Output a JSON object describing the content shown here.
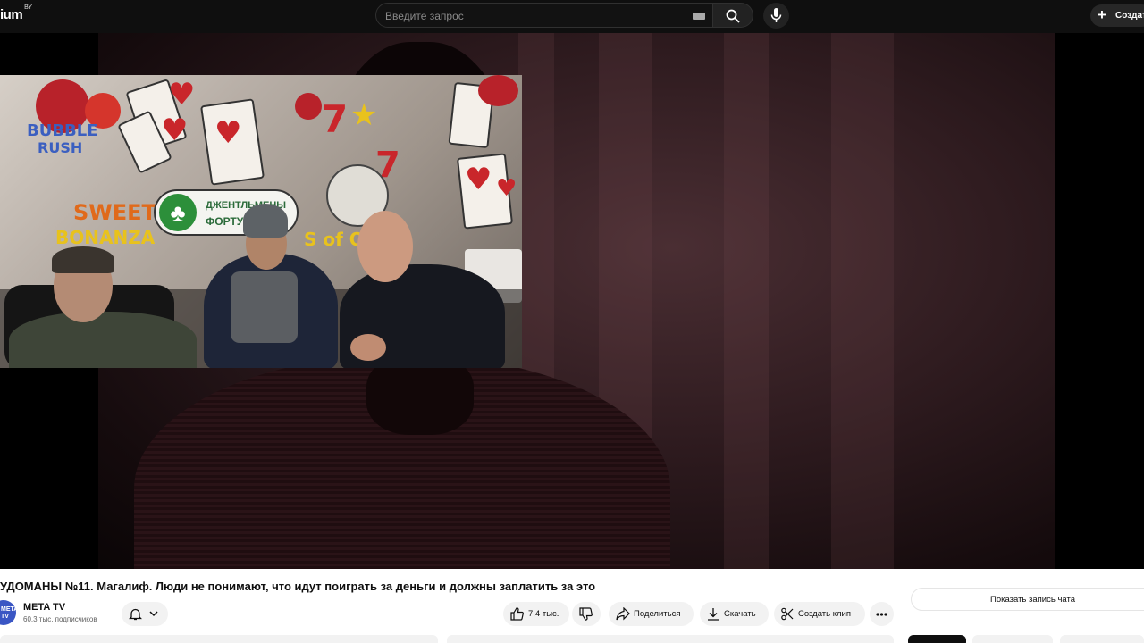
{
  "header": {
    "logo_text": "ium",
    "logo_badge": "BY",
    "search_placeholder": "Введите запрос",
    "create_label": "Создать"
  },
  "video": {
    "overlay_sign_line1": "ДЖЕНТЛЬМЕНЫ",
    "overlay_sign_line2": "ФОРТУНЫ"
  },
  "info": {
    "title": "УДОМАНЫ №11. Магалиф. Люди не понимают, что идут поиграть за деньги и должны заплатить за это",
    "channel": {
      "avatar_text": "META TV",
      "name": "META TV",
      "subscribers": "60,3 тыс. подписчиков"
    },
    "actions": {
      "likes": "7,4 тыс.",
      "share": "Поделиться",
      "download": "Скачать",
      "clip": "Создать клип"
    },
    "chat_replay": "Показать запись чата"
  }
}
